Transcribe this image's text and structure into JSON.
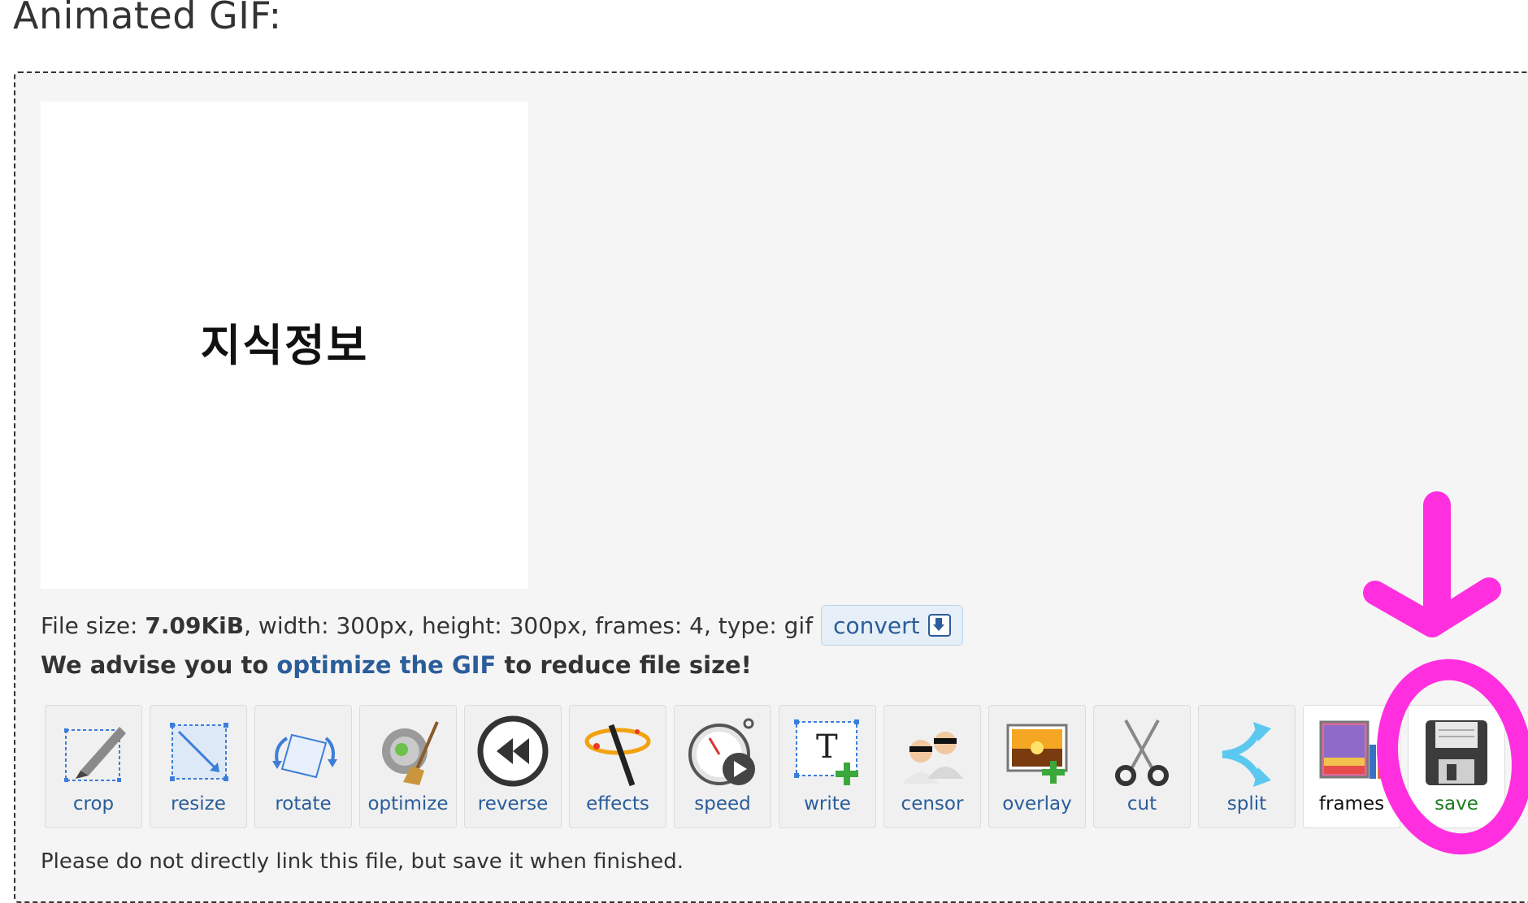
{
  "heading": "Animated GIF:",
  "preview": {
    "text": "지식정보"
  },
  "info": {
    "file_size_label": "File size:",
    "file_size": "7.09KiB",
    "rest": ", width: 300px, height: 300px, frames: 4, type: gif",
    "convert_label": "convert"
  },
  "advise": {
    "prefix": "We advise you to",
    "link": "optimize the GIF",
    "suffix": "to reduce file size!"
  },
  "tools": [
    {
      "label": "crop",
      "icon": "crop-icon"
    },
    {
      "label": "resize",
      "icon": "resize-icon"
    },
    {
      "label": "rotate",
      "icon": "rotate-icon"
    },
    {
      "label": "optimize",
      "icon": "optimize-icon"
    },
    {
      "label": "reverse",
      "icon": "reverse-icon"
    },
    {
      "label": "effects",
      "icon": "effects-icon"
    },
    {
      "label": "speed",
      "icon": "speed-icon"
    },
    {
      "label": "write",
      "icon": "write-icon"
    },
    {
      "label": "censor",
      "icon": "censor-icon"
    },
    {
      "label": "overlay",
      "icon": "overlay-icon"
    },
    {
      "label": "cut",
      "icon": "scissors-icon"
    },
    {
      "label": "split",
      "icon": "split-icon"
    },
    {
      "label": "frames",
      "icon": "frames-icon"
    },
    {
      "label": "save",
      "icon": "floppy-disk-icon"
    }
  ],
  "footer": "Please do not directly link this file, but save it when finished.",
  "colors": {
    "link": "#2a5d9a",
    "annotation": "#ff2fe0",
    "save_label": "#1e7a1e"
  }
}
